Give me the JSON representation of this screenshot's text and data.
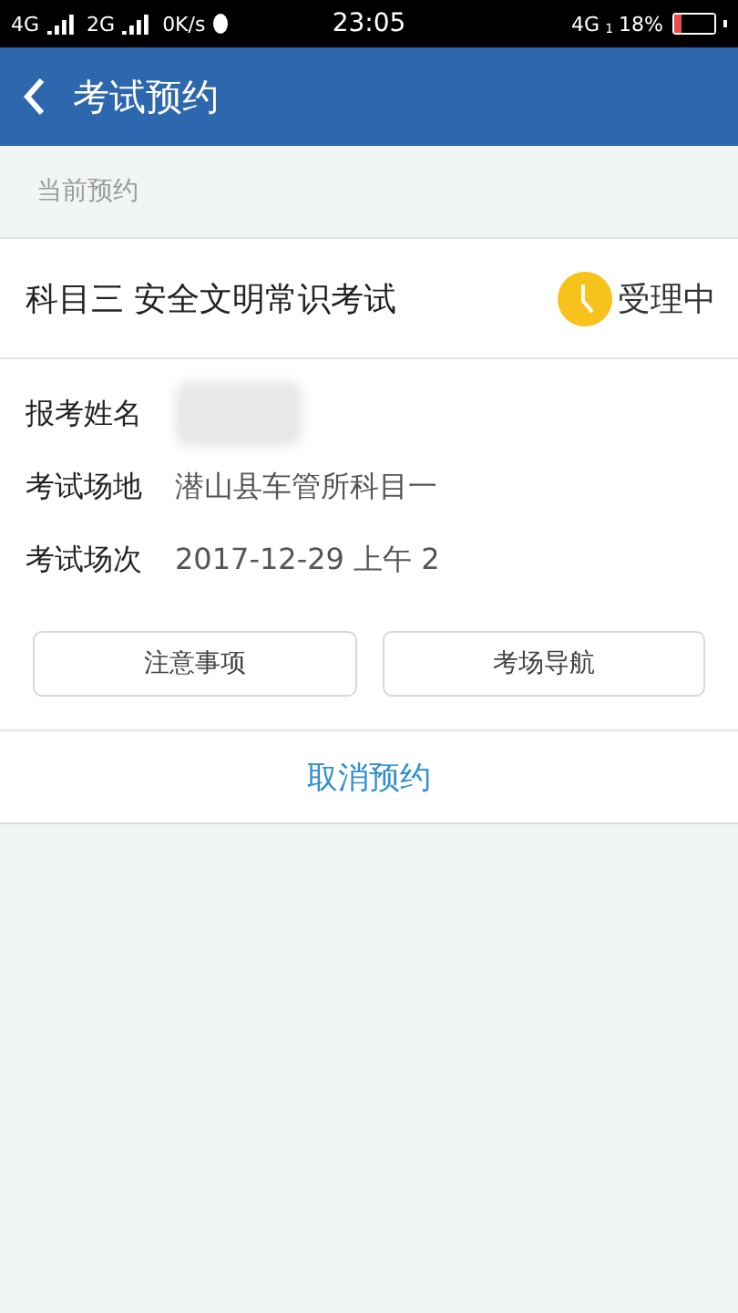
{
  "status_bar": {
    "network_1": "4G",
    "network_2": "2G",
    "speed": "0K/s",
    "time": "23:05",
    "network_3": "4G",
    "sim": "1",
    "battery": "18%"
  },
  "header": {
    "title": "考试预约"
  },
  "section": {
    "label": "当前预约"
  },
  "appointment": {
    "title": "科目三 安全文明常识考试",
    "status": "受理中",
    "fields": [
      {
        "label": "报考姓名",
        "kind": "redacted"
      },
      {
        "label": "考试场地",
        "kind": "text",
        "value": "潜山县车管所科目一"
      },
      {
        "label": "考试场次",
        "kind": "text",
        "value": "2017-12-29 上午 2"
      }
    ],
    "buttons": [
      "注意事项",
      "考场导航"
    ],
    "cancel": "取消预约"
  }
}
